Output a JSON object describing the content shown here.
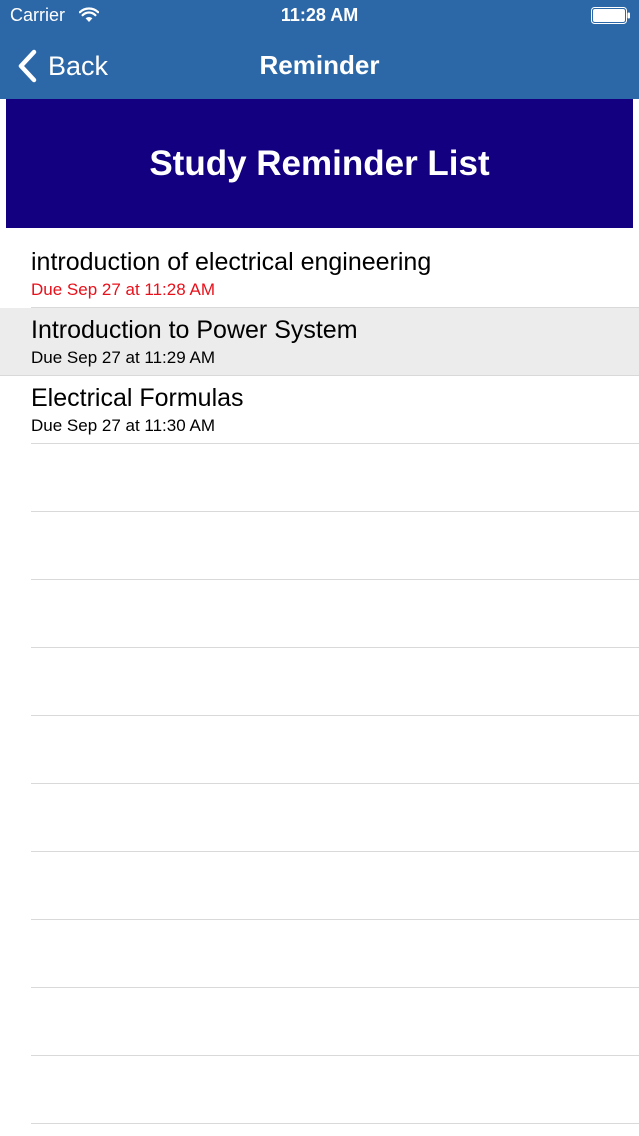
{
  "status_bar": {
    "carrier": "Carrier",
    "time": "11:28 AM"
  },
  "nav": {
    "back_label": "Back",
    "title": "Reminder"
  },
  "banner": {
    "title": "Study Reminder List"
  },
  "colors": {
    "nav_background": "#2c68a8",
    "banner_background": "#120080",
    "overdue_text": "#e8101a",
    "selected_row": "#ececec"
  },
  "reminders": [
    {
      "title": "introduction of electrical engineering",
      "due": "Due Sep 27 at 11:28 AM"
    },
    {
      "title": "Introduction to Power System",
      "due": "Due Sep 27 at 11:29 AM"
    },
    {
      "title": "Electrical Formulas",
      "due": "Due Sep 27 at 11:30 AM"
    }
  ]
}
